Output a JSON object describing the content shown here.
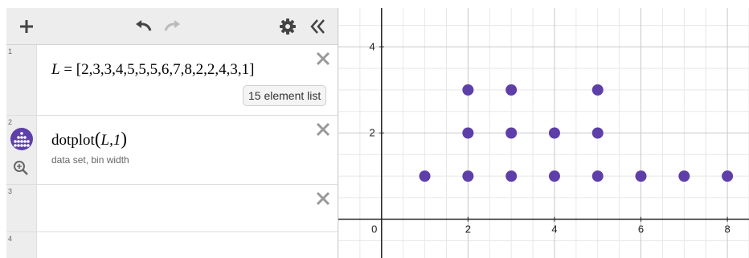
{
  "toolbar": {
    "add": "add-expression",
    "undo": "undo",
    "redo": "redo",
    "settings": "settings",
    "collapse": "collapse-panel"
  },
  "expressions": [
    {
      "num": "1",
      "math_lhs": "L",
      "math_eq": "=",
      "math_rhs": "[2,3,3,4,5,5,5,6,7,8,2,2,4,3,1]",
      "badge": "15 element list"
    },
    {
      "num": "2",
      "func": "dotplot",
      "args": "L,1",
      "hint": "data set, bin width",
      "icon": "dotplot-icon"
    },
    {
      "num": "3"
    },
    {
      "num": "4"
    }
  ],
  "graph": {
    "x_ticks": [
      "0",
      "2",
      "4",
      "6",
      "8"
    ],
    "y_ticks": [
      "2",
      "4"
    ],
    "dot_color": "#5e3fa9"
  },
  "chart_data": {
    "type": "scatter",
    "x": [
      1,
      2,
      2,
      2,
      3,
      3,
      3,
      4,
      4,
      5,
      5,
      5,
      6,
      7,
      8
    ],
    "y": [
      1,
      1,
      2,
      3,
      1,
      2,
      3,
      1,
      2,
      1,
      2,
      3,
      1,
      1,
      1
    ],
    "xlim": [
      -1,
      8.5
    ],
    "ylim": [
      -0.9,
      4.9
    ],
    "grid": true
  }
}
